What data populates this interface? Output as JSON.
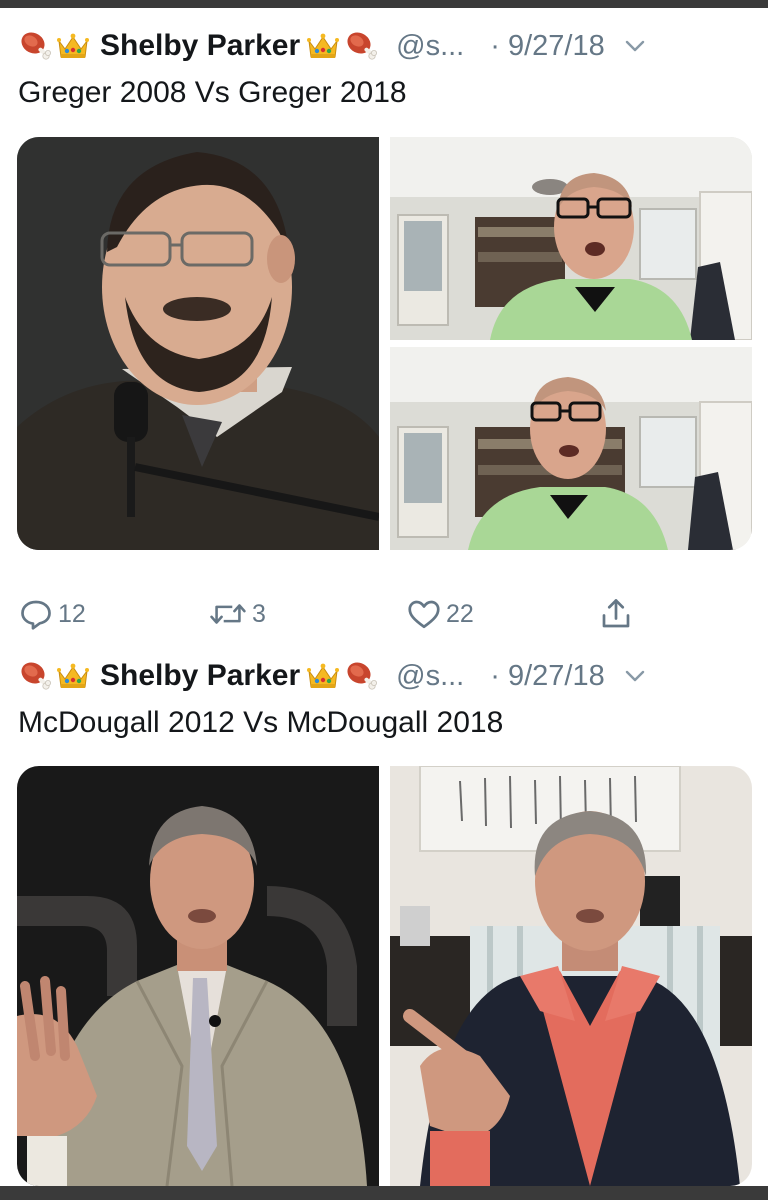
{
  "tweets": [
    {
      "display_name": "Shelby Parker",
      "handle": "@s...",
      "date": "· 9/27/18",
      "text": "Greger 2008 Vs Greger 2018",
      "media": [
        {
          "label": "Greger 2008 photo"
        },
        {
          "label": "Greger 2018 photo top"
        },
        {
          "label": "Greger 2018 photo bottom"
        }
      ],
      "actions": {
        "reply_count": "12",
        "retweet_count": "3",
        "like_count": "22"
      }
    },
    {
      "display_name": "Shelby Parker",
      "handle": "@s...",
      "date": "· 9/27/18",
      "text": "McDougall 2012 Vs McDougall 2018",
      "media": [
        {
          "label": "McDougall 2012 photo"
        },
        {
          "label": "McDougall 2018 photo"
        }
      ]
    }
  ],
  "icons": {
    "name_emoji_left": [
      "meat-on-bone-icon",
      "crown-icon"
    ],
    "name_emoji_right": [
      "crown-icon",
      "meat-on-bone-icon"
    ],
    "chevron": "chevron-down-icon",
    "reply": "reply-icon",
    "retweet": "retweet-icon",
    "like": "heart-icon",
    "share": "share-icon"
  },
  "colors": {
    "text_primary": "#14171a",
    "text_secondary": "#657786",
    "background": "#ffffff"
  }
}
